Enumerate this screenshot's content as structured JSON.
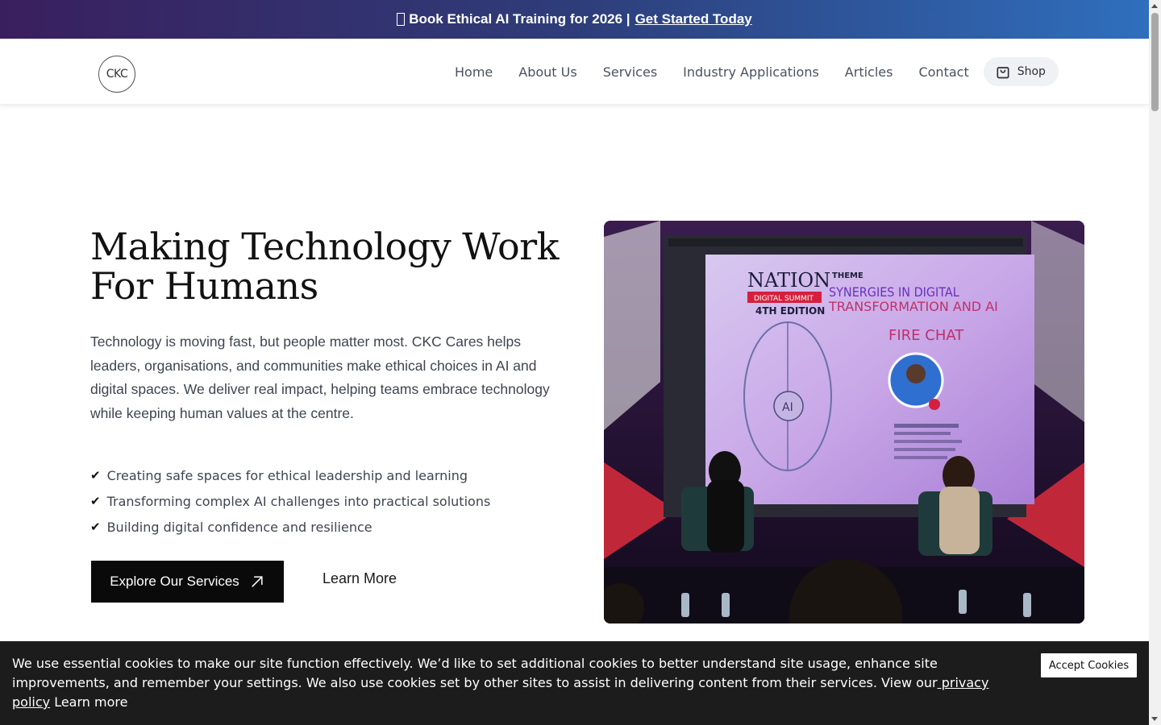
{
  "announcement": {
    "icon": "sparkle-icon",
    "text": "Book Ethical AI Training for 2026 |",
    "cta": "Get Started Today"
  },
  "header": {
    "logo_text": "CKC",
    "nav": [
      {
        "label": "Home"
      },
      {
        "label": "About Us"
      },
      {
        "label": "Services"
      },
      {
        "label": "Industry Applications"
      },
      {
        "label": "Articles"
      },
      {
        "label": "Contact"
      }
    ],
    "shop_label": "Shop"
  },
  "hero": {
    "title": "Making Technology Work For Humans",
    "description": "Technology is moving fast, but people matter most. CKC Cares helps leaders, organisations, and communities make ethical choices in AI and digital spaces. We deliver real impact, helping teams embrace technology while keeping human values at the centre.",
    "bullets": [
      "Creating safe spaces for ethical leadership and learning",
      "Transforming complex AI challenges into practical solutions",
      "Building digital confidence and resilience"
    ],
    "check_glyph": "✔",
    "primary_button": "Explore Our Services",
    "secondary_button": "Learn More"
  },
  "hero_image": {
    "screen_brand": "NATION",
    "screen_sub": "DIGITAL SUMMIT",
    "screen_edition": "4TH EDITION",
    "screen_theme_tag": "THEME",
    "screen_theme_line1": "SYNERGIES IN DIGITAL",
    "screen_theme_line2": "TRANSFORMATION AND AI",
    "screen_fire": "FIRE CHAT",
    "screen_brain_label": "AI"
  },
  "cookie": {
    "text": "We use essential cookies to make our site function effectively. We’d like to set additional cookies to better understand site usage, enhance site improvements, and remember your settings. We also use cookies set by other sites to assist in delivering content from their services. View our",
    "privacy_link": " privacy policy",
    "learn_more": "Learn more",
    "accept_button": "Accept Cookies"
  },
  "colors": {
    "announce_start": "#3a1f5e",
    "announce_end": "#2f6fbd",
    "primary_button": "#0a0a0a",
    "cookie_bg": "#1c1c1c"
  }
}
